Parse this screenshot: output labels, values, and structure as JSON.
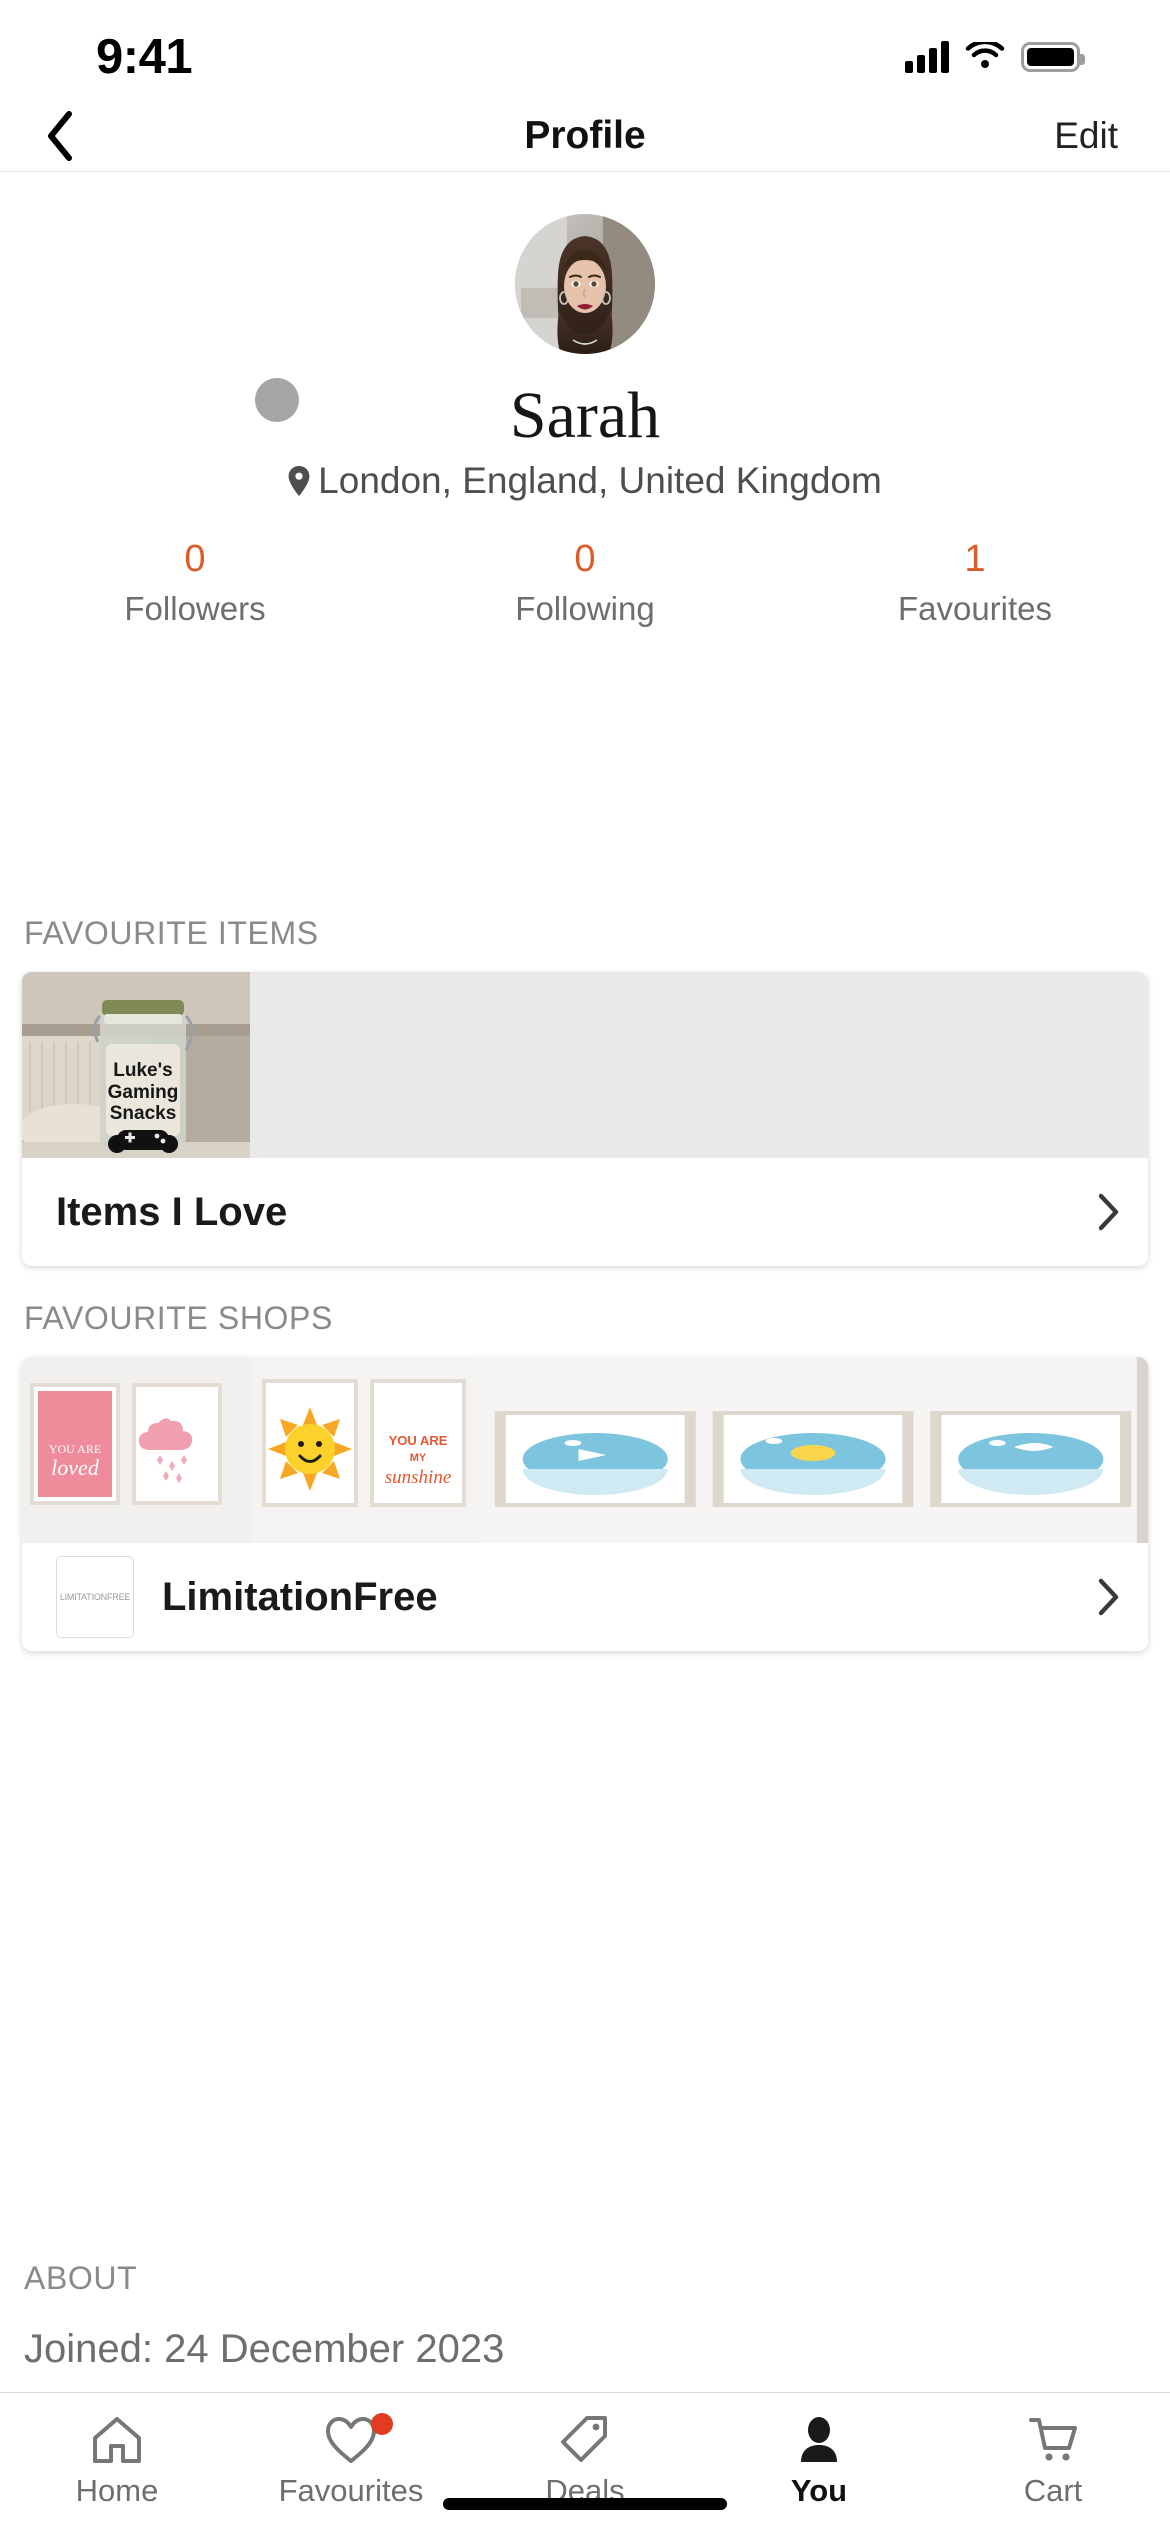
{
  "status_bar": {
    "time": "9:41",
    "signal_icon": "cellular-signal-icon",
    "wifi_icon": "wifi-icon",
    "battery_icon": "battery-icon"
  },
  "nav": {
    "back_icon": "chevron-left-icon",
    "title": "Profile",
    "edit_label": "Edit"
  },
  "profile": {
    "avatar_alt": "profile-photo",
    "name": "Sarah",
    "location_icon": "map-pin-icon",
    "location": "London, England, United Kingdom",
    "accent_color": "#dd5b28",
    "stats": [
      {
        "value": "0",
        "label": "Followers"
      },
      {
        "value": "0",
        "label": "Following"
      },
      {
        "value": "1",
        "label": "Favourites"
      }
    ]
  },
  "favourite_items": {
    "section_title": "FAVOURITE ITEMS",
    "item": {
      "image_alt": "gaming-snacks-jar-photo",
      "image_caption": "Luke's Gaming Snacks",
      "title": "Items I Love",
      "chevron_icon": "chevron-right-icon"
    }
  },
  "favourite_shops": {
    "section_title": "FAVOURITE SHOPS",
    "shop": {
      "image_alt": "wall-art-prints-photo",
      "logo_text": "LIMITATIONFREE",
      "poster_texts": [
        "you are loved",
        "YOU ARE",
        "sunshine"
      ],
      "name": "LimitationFree",
      "chevron_icon": "chevron-right-icon"
    }
  },
  "about": {
    "section_title": "ABOUT",
    "joined": "Joined: 24 December 2023"
  },
  "tabbar": {
    "items": [
      {
        "label": "Home",
        "icon": "home-icon",
        "active": false,
        "badge": false
      },
      {
        "label": "Favourites",
        "icon": "heart-icon",
        "active": false,
        "badge": true
      },
      {
        "label": "Deals",
        "icon": "tag-icon",
        "active": false,
        "badge": false
      },
      {
        "label": "You",
        "icon": "person-icon",
        "active": true,
        "badge": false
      },
      {
        "label": "Cart",
        "icon": "cart-icon",
        "active": false,
        "badge": false
      }
    ]
  }
}
